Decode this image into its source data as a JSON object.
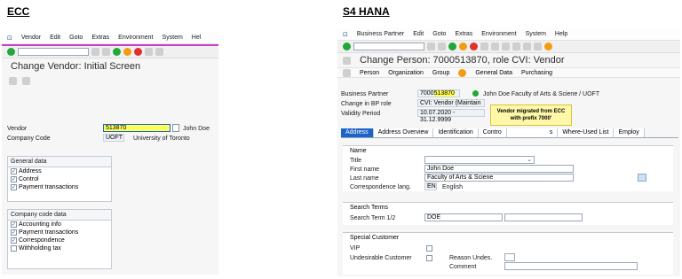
{
  "left": {
    "heading": "ECC",
    "menu": [
      "Vendor",
      "Edit",
      "Goto",
      "Extras",
      "Environment",
      "System",
      "Hel"
    ],
    "title": "Change Vendor:  Initial Screen",
    "vendor_label": "Vendor",
    "vendor_value": "513870",
    "vendor_name": "John Doe",
    "company_code_label": "Company Code",
    "company_code_value": "UOFT",
    "company_code_name": "University of Toronto",
    "general_data": {
      "title": "General data",
      "items": [
        "Address",
        "Control",
        "Payment transactions"
      ]
    },
    "company_code_data": {
      "title": "Company code data",
      "items": [
        {
          "label": "Accounting info",
          "checked": true
        },
        {
          "label": "Payment transactions",
          "checked": true
        },
        {
          "label": "Correspondence",
          "checked": true
        },
        {
          "label": "Withholding tax",
          "checked": false
        }
      ]
    }
  },
  "right": {
    "heading": "S4 HANA",
    "menu": [
      "Business Partner",
      "Edit",
      "Goto",
      "Extras",
      "Environment",
      "System",
      "Help"
    ],
    "title": "Change Person: 7000513870, role CVI: Vendor",
    "app_toolbar": [
      "Person",
      "Organization",
      "Group",
      "General Data",
      "Purchasing"
    ],
    "bp_label": "Business Partner",
    "bp_prefix": "7000",
    "bp_rest": "513870",
    "bp_name": "John Doe Faculty of Arts & Sciene / UOFT",
    "role_label": "Change in BP role",
    "role_value": "CVI: Vendor (Maintain",
    "validity_label": "Validity Period",
    "validity_value": "10.07.2020 - 31.12.9999",
    "callout": "Vendor migrated from ECC with prefix 7000'",
    "tabs": [
      "Address",
      "Address Overview",
      "Identification",
      "Contro",
      "s",
      "Where-Used List",
      "Employ"
    ],
    "name_section": {
      "title": "Name",
      "title_label": "Title",
      "first_name_label": "First name",
      "first_name": "John Doe",
      "last_name_label": "Last name",
      "last_name": "Faculty of Arts & Sciene",
      "corr_lang_label": "Correspondence lang.",
      "corr_lang_code": "EN",
      "corr_lang_name": "English"
    },
    "search_section": {
      "title": "Search Terms",
      "label": "Search Term 1/2",
      "value1": "DOE",
      "value2": ""
    },
    "special_section": {
      "title": "Special Customer",
      "vip_label": "VIP",
      "undesirable_label": "Undesirable Customer",
      "reason_label": "Reason Undes.",
      "comment_label": "Comment"
    }
  }
}
